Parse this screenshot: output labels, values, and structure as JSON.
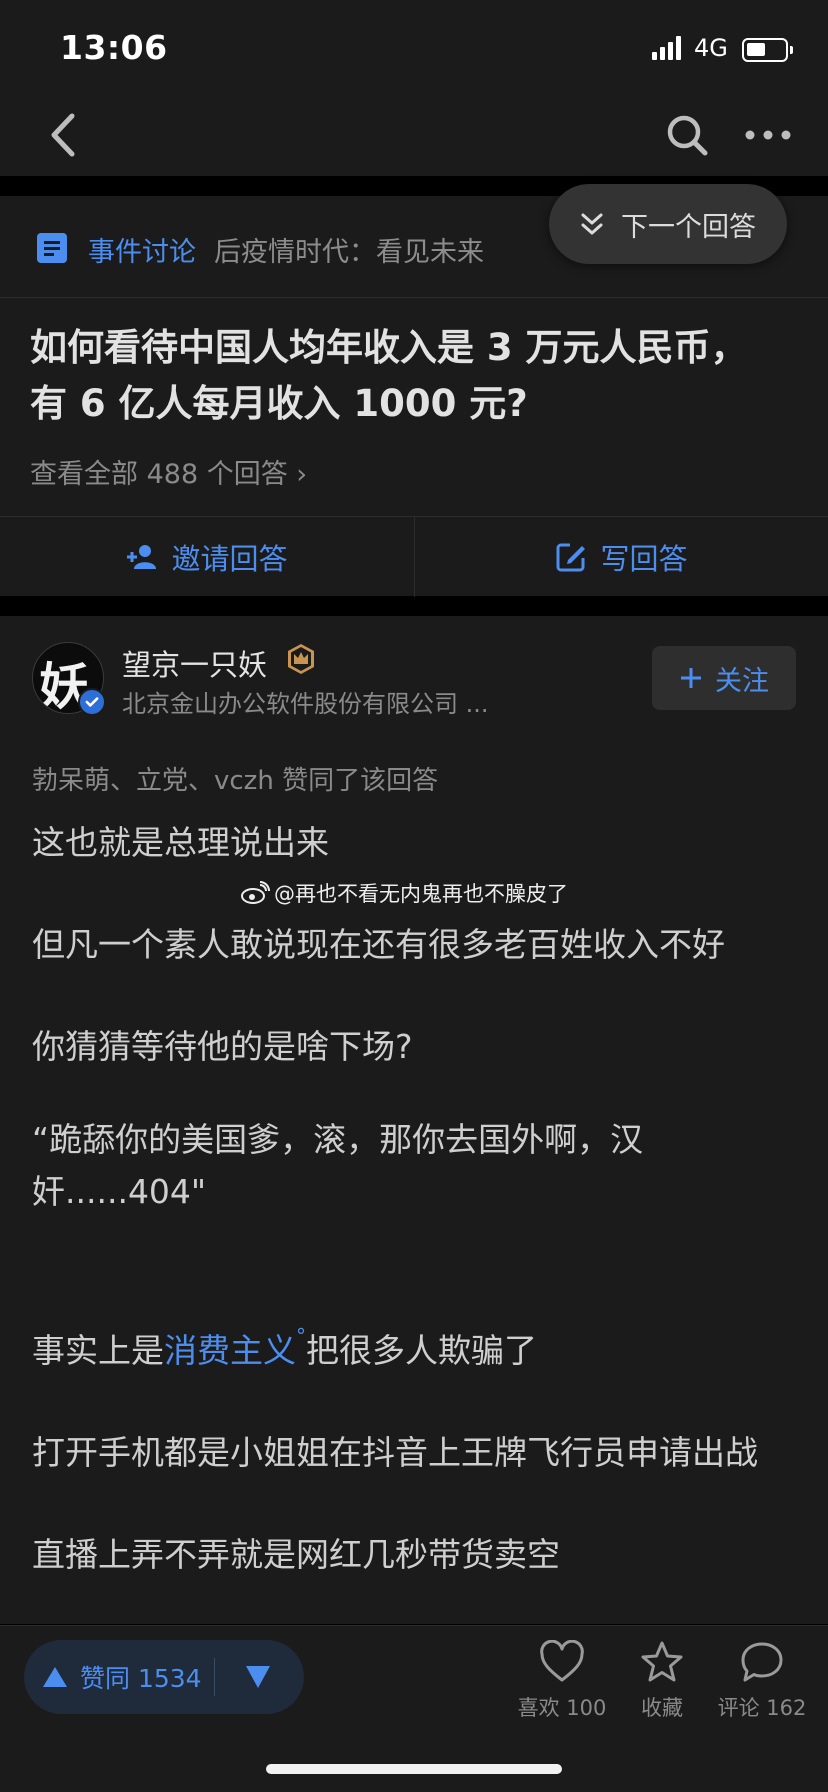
{
  "status": {
    "time": "13:06",
    "network": "4G",
    "battery_level": 0.45
  },
  "nav": {
    "back_icon": "chevron-left-icon",
    "search_icon": "search-icon",
    "more_icon": "more-dots-icon"
  },
  "topic": {
    "label": "事件讨论",
    "title": "后疫情时代：看见未来",
    "question": "如何看待中国人均年收入是 3 万元人民币，有 6 亿人每月收入 1000 元?",
    "view_all": "查看全部 488 个回答 ›",
    "invite_label": "邀请回答",
    "write_label": "写回答"
  },
  "next_answer": {
    "label": "下一个回答"
  },
  "answer": {
    "author_name": "望京一只妖",
    "author_org": "北京金山办公软件股份有限公司 ...",
    "avatar_char": "妖",
    "follow_label": "关注",
    "voters": "勃呆萌、立党、vczh 赞同了该回答",
    "watermark": "@再也不看无内鬼再也不臊皮了",
    "lines": {
      "p1": "这也就是总理说出来",
      "p2": "但凡一个素人敢说现在还有很多老百姓收入不好",
      "p3": "你猜猜等待他的是啥下场?",
      "p4": "“跪舔你的美国爹，滚，那你去国外啊，汉奸......404\"",
      "p5_before": "事实上是",
      "p5_link": "消费主义",
      "p5_after": "把很多人欺骗了",
      "p6": "打开手机都是小姐姐在抖音上王牌飞行员申请出战",
      "p7": "直播上弄不弄就是网红几秒带货卖空"
    }
  },
  "bottom": {
    "upvote_label": "赞同 1534",
    "like_label": "喜欢 100",
    "collect_label": "收藏",
    "comment_label": "评论 162"
  },
  "colors": {
    "accent": "#4c8ef0",
    "background": "#1b1b1b",
    "crown": "#c8944e"
  }
}
